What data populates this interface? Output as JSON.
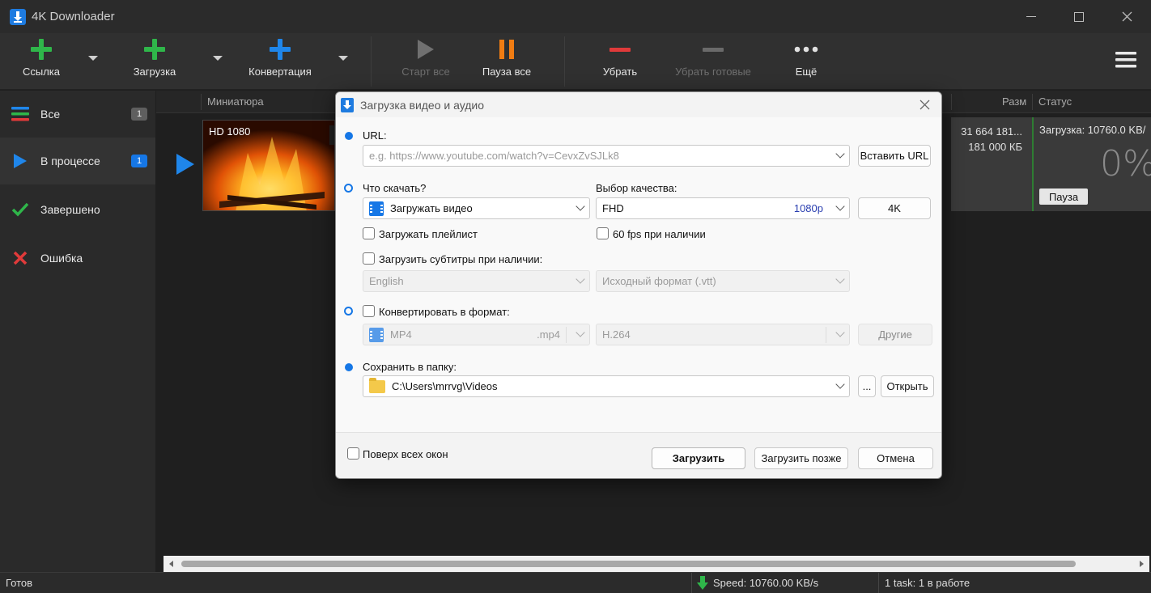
{
  "window": {
    "title": "4K Downloader",
    "controls": [
      "minimize",
      "maximize",
      "close"
    ]
  },
  "toolbar": {
    "link_label": "Ссылка",
    "download_label": "Загрузка",
    "convert_label": "Конвертация",
    "start_all_label": "Старт все",
    "pause_all_label": "Пауза все",
    "remove_label": "Убрать",
    "remove_done_label": "Убрать готовые",
    "more_label": "Ещё"
  },
  "sidebar": {
    "items": [
      {
        "label": "Все",
        "badge": "1"
      },
      {
        "label": "В процессе",
        "badge": "1"
      },
      {
        "label": "Завершено",
        "badge": ""
      },
      {
        "label": "Ошибка",
        "badge": ""
      }
    ]
  },
  "list": {
    "columns": {
      "thumbnail": "Миниатюра",
      "size": "Разм",
      "status": "Статус"
    },
    "row": {
      "thumb_label": "HD 1080",
      "size_line1": "31 664 181...",
      "size_line2": "181 000 КБ",
      "status_text": "Загрузка: 10760.0 KB/",
      "percent": "0%",
      "pause_label": "Пауза"
    }
  },
  "statusbar": {
    "left": "Готов",
    "speed": "Speed: 10760.00 KB/s",
    "tasks": "1 task: 1 в работе"
  },
  "dialog": {
    "title": "Загрузка видео и аудио",
    "url_label": "URL:",
    "url_placeholder": "e.g. https://www.youtube.com/watch?v=CevxZvSJLk8",
    "paste_url_label": "Вставить URL",
    "what_label": "Что скачать?",
    "what_value": "Загружать видео",
    "quality_label": "Выбор качества:",
    "quality_value": "FHD",
    "quality_res": "1080p",
    "btn_4k": "4K",
    "playlist_label": "Загружать плейлист",
    "fps_label": "60 fps при наличии",
    "subs_label": "Загрузить субтитры при наличии:",
    "subs_lang": "English",
    "subs_format": "Исходный формат (.vtt)",
    "convert_label": "Конвертировать в формат:",
    "convert_format": "MP4",
    "convert_ext": ".mp4",
    "convert_codec": "H.264",
    "other_label": "Другие",
    "save_label": "Сохранить в папку:",
    "save_path": "C:\\Users\\mrrvg\\Videos",
    "browse_label": "...",
    "open_label": "Открыть",
    "ontop_label": "Поверх всех окон",
    "download_label": "Загрузить",
    "download_later_label": "Загрузить позже",
    "cancel_label": "Отмена"
  },
  "colors": {
    "accent": "#1677e6",
    "green": "#2fb64a",
    "orange": "#f07c12",
    "red": "#e03a3a"
  }
}
